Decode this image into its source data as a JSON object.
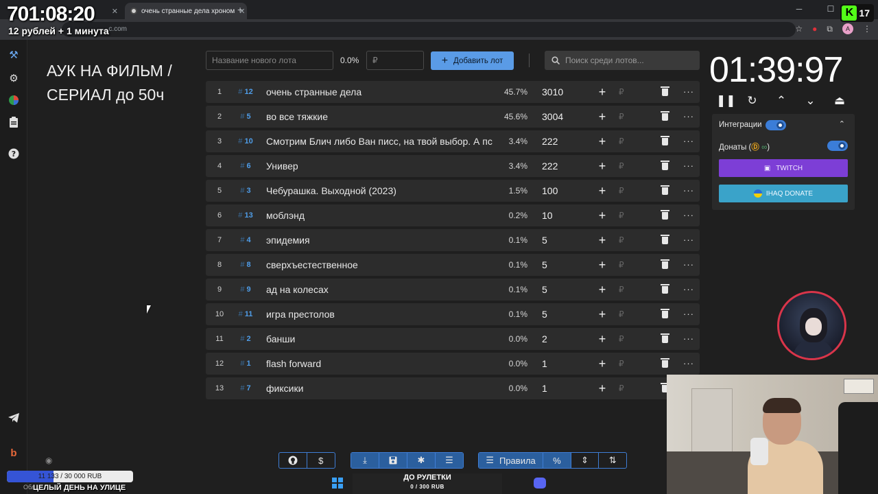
{
  "overlay": {
    "timer": "701:08:20",
    "subtitle": "12 рублей + 1 минута",
    "kick_count": "17",
    "donation_progress": "11 133 / 30 000 RUB",
    "donation_fraction": 0.371,
    "street_text": "ЦЕЛЫЙ ДЕНЬ НА УЛИЦЕ",
    "street_prefix": "Обл",
    "roulette_title": "ДО РУЛЕТКИ",
    "roulette_progress": "0 / 300 RUB"
  },
  "browser": {
    "tab1_title": "",
    "tab2_title": "очень странные дела хроном",
    "url": "...c.com",
    "profile_initial": "A"
  },
  "sidebar": {
    "icons": [
      "gavel-icon",
      "gear-icon",
      "pie-chart-icon",
      "clipboard-icon",
      "help-icon",
      "telegram-icon",
      "boosty-icon"
    ]
  },
  "auction": {
    "title": "АУК НА ФИЛЬМ / СЕРИАЛ до 50ч",
    "new_lot_placeholder": "Название нового лота",
    "new_lot_percent": "0.0%",
    "amount_placeholder": "₽",
    "add_button_label": "Добавить лот",
    "search_placeholder": "Поиск среди лотов...",
    "currency_symbol": "₽",
    "lots": [
      {
        "index": "1",
        "id": "12",
        "name": "очень странные дела",
        "percent": "45.7%",
        "amount": "3010"
      },
      {
        "index": "2",
        "id": "5",
        "name": "во все тяжкие",
        "percent": "45.6%",
        "amount": "3004"
      },
      {
        "index": "3",
        "id": "10",
        "name": "Смотрим Блич либо Ван писс, на твой выбор. А пс",
        "percent": "3.4%",
        "amount": "222"
      },
      {
        "index": "4",
        "id": "6",
        "name": "Универ",
        "percent": "3.4%",
        "amount": "222"
      },
      {
        "index": "5",
        "id": "3",
        "name": "Чебурашка. Выходной (2023)",
        "percent": "1.5%",
        "amount": "100"
      },
      {
        "index": "6",
        "id": "13",
        "name": "моблэнд",
        "percent": "0.2%",
        "amount": "10"
      },
      {
        "index": "7",
        "id": "4",
        "name": "эпидемия",
        "percent": "0.1%",
        "amount": "5"
      },
      {
        "index": "8",
        "id": "8",
        "name": "сверхъестественное",
        "percent": "0.1%",
        "amount": "5"
      },
      {
        "index": "9",
        "id": "9",
        "name": "ад на колесах",
        "percent": "0.1%",
        "amount": "5"
      },
      {
        "index": "10",
        "id": "11",
        "name": "игра престолов",
        "percent": "0.1%",
        "amount": "5"
      },
      {
        "index": "11",
        "id": "2",
        "name": "банши",
        "percent": "0.0%",
        "amount": "2"
      },
      {
        "index": "12",
        "id": "1",
        "name": "flash forward",
        "percent": "0.0%",
        "amount": "1"
      },
      {
        "index": "13",
        "id": "7",
        "name": "фиксики",
        "percent": "0.0%",
        "amount": "1"
      }
    ]
  },
  "right_panel": {
    "timer": "01:39:97",
    "integrations_label": "Интеграции",
    "donations_label_prefix": "Донаты (",
    "donations_label_suffix": ")",
    "twitch_label": "TWITCH",
    "donate_label": "IHAQ DONATE"
  },
  "toolbar": {
    "rules_label": "Правила",
    "percent_label": "%"
  },
  "colors": {
    "accent": "#5a9be6",
    "twitch": "#7d3ed6",
    "donate": "#3aa3c9",
    "lot_id": "#4f9de8"
  }
}
